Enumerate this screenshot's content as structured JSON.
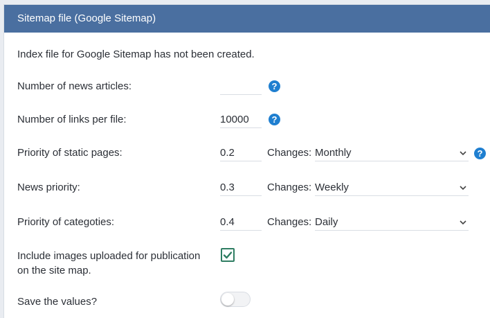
{
  "header": {
    "title": "Sitemap file (Google Sitemap)"
  },
  "info_text": "Index file for Google Sitemap has not been created.",
  "help_glyph": "?",
  "rows": {
    "news_articles": {
      "label": "Number of news articles:",
      "value": ""
    },
    "links_per_file": {
      "label": "Number of links per file:",
      "value": "10000"
    },
    "static_pages": {
      "label": "Priority of static pages:",
      "value": "0.2",
      "changes_label": "Changes:",
      "changes_value": "Monthly"
    },
    "news_priority": {
      "label": "News priority:",
      "value": "0.3",
      "changes_label": "Changes:",
      "changes_value": "Weekly"
    },
    "categories": {
      "label": "Priority of categoties:",
      "value": "0.4",
      "changes_label": "Changes:",
      "changes_value": "Daily"
    },
    "include_images": {
      "label_line1": "Include images uploaded for publication",
      "label_line2": "on the site map.",
      "checked": true
    },
    "save_values": {
      "label": "Save the values?",
      "enabled": false
    }
  },
  "colors": {
    "header_bg": "#4a6fa0",
    "help_icon": "#1f7fd0",
    "checkbox": "#2e7d62"
  },
  "icons": {
    "help": "help-circle-icon",
    "dropdown": "chevron-down-icon",
    "checkbox": "checkmark-icon"
  }
}
